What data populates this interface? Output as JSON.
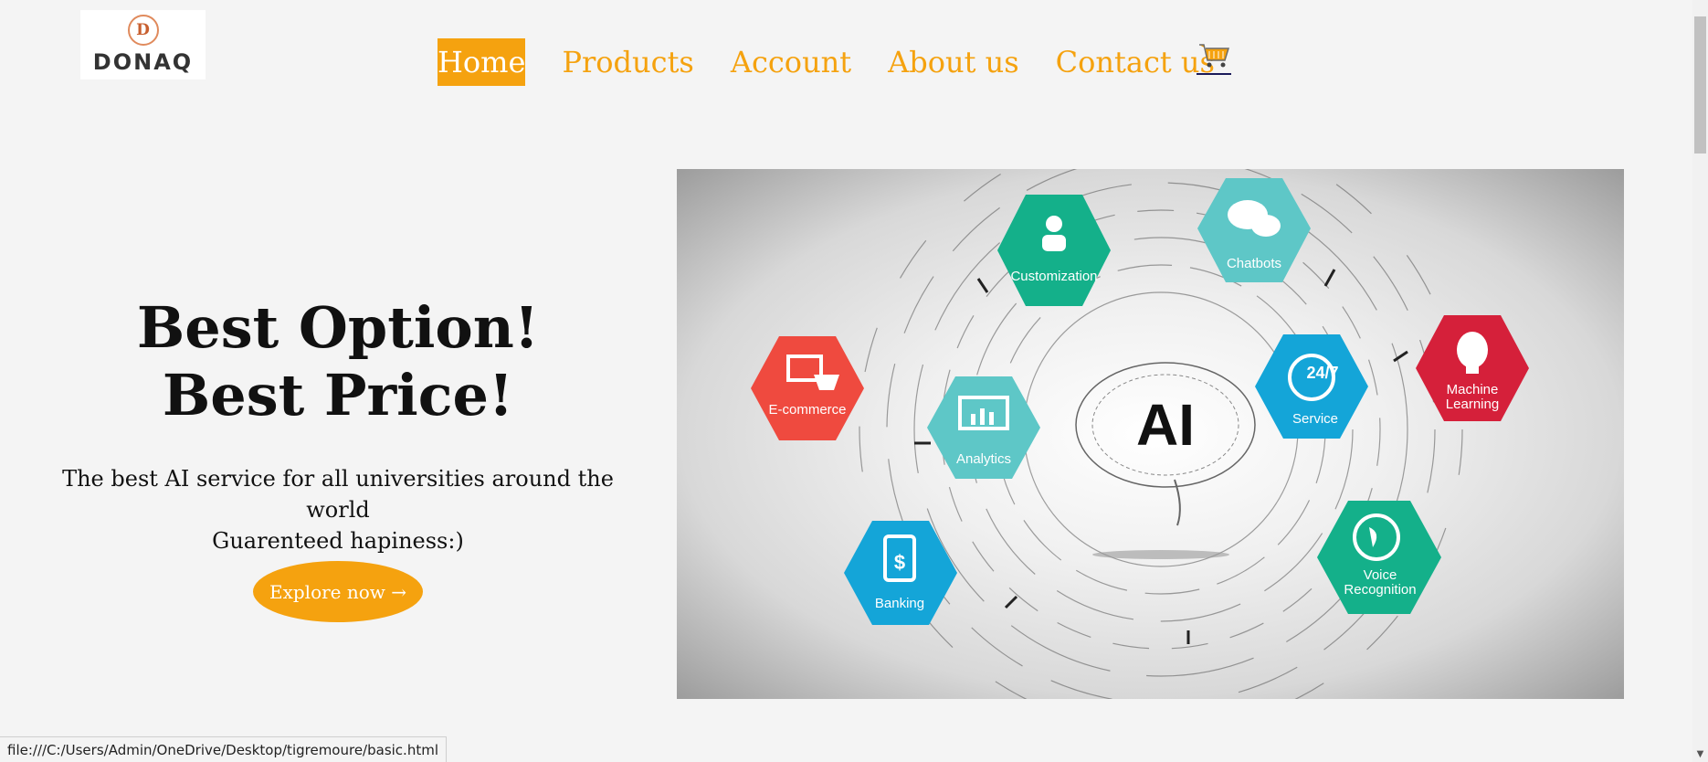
{
  "logo": {
    "mark": "D",
    "text": "DONAQ"
  },
  "nav": {
    "items": [
      "Home",
      "Products",
      "Account",
      "About us",
      "Contact us"
    ],
    "active": "Home",
    "cart_icon": "cart-icon"
  },
  "hero": {
    "headline_line1": "Best Option!",
    "headline_line2": "Best Price!",
    "tagline_line1": "The best AI service for all universities around the world",
    "tagline_line2": "Guarenteed hapiness:)",
    "button_label": "Explore now →"
  },
  "hero_image": {
    "center_text": "AI",
    "hexagons": {
      "customization": "Customization",
      "chatbots": "Chatbots",
      "ecommerce": "E-commerce",
      "analytics": "Analytics",
      "service": "Service",
      "service_badge": "24/7",
      "machine_learning_1": "Machine",
      "machine_learning_2": "Learning",
      "banking": "Banking",
      "voice_1": "Voice",
      "voice_2": "Recognition"
    }
  },
  "statusbar": {
    "url": "file:///C:/Users/Admin/OneDrive/Desktop/tigremoure/basic.html"
  },
  "colors": {
    "accent": "#f5a20f",
    "green": "#14b08a",
    "teal": "#5ec7c7",
    "red": "#ef4a3f",
    "blue": "#14a5d8",
    "crimson": "#d5203a"
  }
}
